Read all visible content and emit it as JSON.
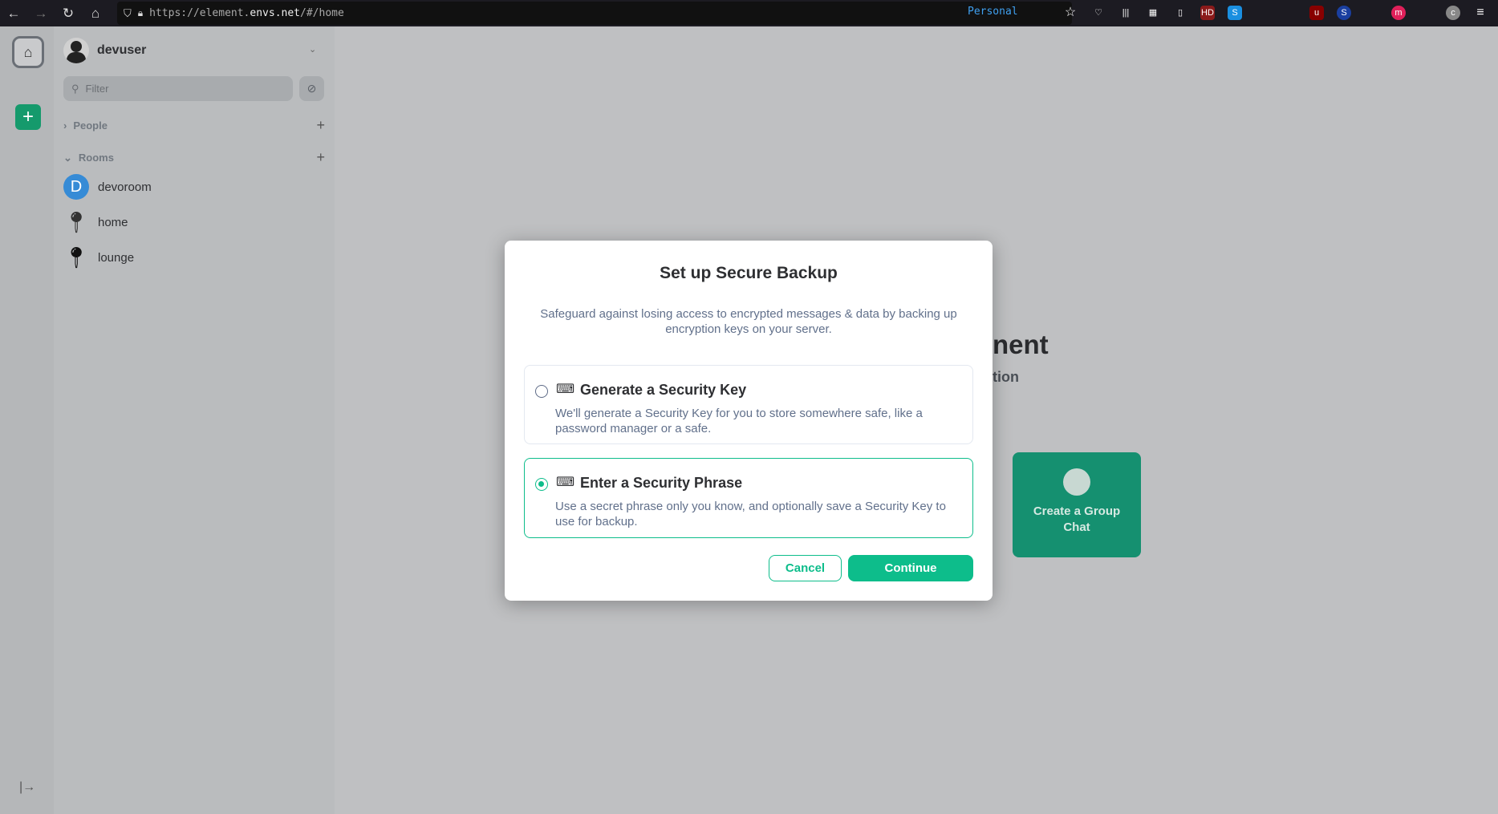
{
  "browser": {
    "url_prefix": "https://element.",
    "url_host": "envs.net",
    "url_path": "/#/home",
    "profile": "Personal"
  },
  "user": {
    "name": "devuser"
  },
  "filter": {
    "placeholder": "Filter"
  },
  "sections": {
    "people": "People",
    "rooms": "Rooms"
  },
  "rooms": [
    {
      "name": "devoroom",
      "initial": "D",
      "color": "#368bd6"
    },
    {
      "name": "home"
    },
    {
      "name": "lounge"
    }
  ],
  "background": {
    "heading_fragment": "nent",
    "subtitle_fragment": "tion",
    "tile_label": "Create a Group Chat"
  },
  "dialog": {
    "title": "Set up Secure Backup",
    "description": "Safeguard against losing access to encrypted messages & data by backing up encryption keys on your server.",
    "options": [
      {
        "title": "Generate a Security Key",
        "description": "We'll generate a Security Key for you to store somewhere safe, like a password manager or a safe.",
        "selected": false
      },
      {
        "title": "Enter a Security Phrase",
        "description": "Use a secret phrase only you know, and optionally save a Security Key to use for backup.",
        "selected": true
      }
    ],
    "cancel": "Cancel",
    "continue": "Continue"
  },
  "colors": {
    "accent": "#0dbd8b",
    "tile": "#159070"
  }
}
